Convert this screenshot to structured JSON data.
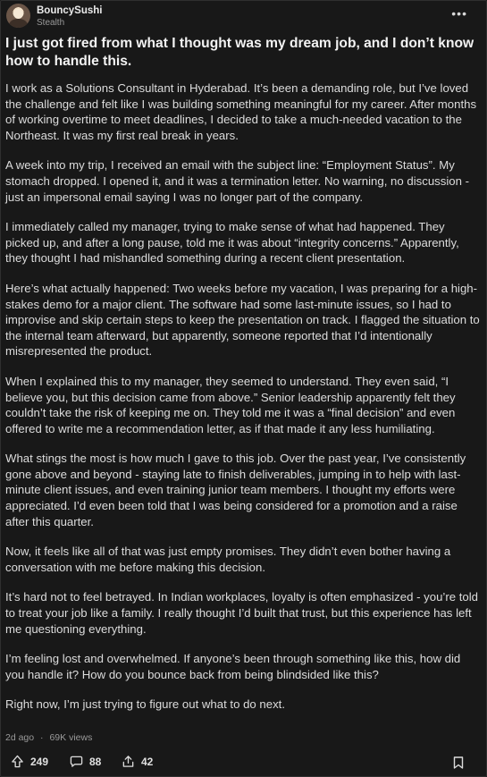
{
  "post": {
    "author": "BouncySushi",
    "author_sub": "Stealth",
    "more_label": "•••",
    "title": "I just got fired from what I thought was my dream job, and I don’t know how to handle this.",
    "paragraphs": [
      "I work as a Solutions Consultant in Hyderabad. It’s been a demanding role, but I’ve loved the challenge and felt like I was building something meaningful for my career. After months of working overtime to meet deadlines, I decided to take a much-needed vacation to the Northeast. It was my first real break in years.",
      "A week into my trip, I received an email with the subject line: “Employment Status”. My stomach dropped. I opened it, and it was a termination letter. No warning, no discussion - just an impersonal email saying I was no longer part of the company.",
      "I immediately called my manager, trying to make sense of what had happened. They picked up, and after a long pause, told me it was about “integrity concerns.” Apparently, they thought I had mishandled something during a recent client presentation.",
      "Here’s what actually happened: Two weeks before my vacation, I was preparing for a high-stakes demo for a major client. The software had some last-minute issues, so I had to improvise and skip certain steps to keep the presentation on track. I flagged the situation to the internal team afterward, but apparently, someone reported that I’d intentionally misrepresented the product.",
      "When I explained this to my manager, they seemed to understand. They even said, “I believe you, but this decision came from above.” Senior leadership apparently felt they couldn’t take the risk of keeping me on. They told me it was a “final decision” and even offered to write me a recommendation letter, as if that made it any less humiliating.",
      "What stings the most is how much I gave to this job. Over the past year, I’ve consistently gone above and beyond - staying late to finish deliverables, jumping in to help with last-minute client issues, and even training junior team members. I thought my efforts were appreciated. I’d even been told that I was being considered for a promotion and a raise after this quarter.",
      "Now, it feels like all of that was just empty promises. They didn’t even bother having a conversation with me before making this decision.",
      "It’s hard not to feel betrayed. In Indian workplaces, loyalty is often emphasized - you’re told to treat your job like a family. I really thought I’d built that trust, but this experience has left me questioning everything.",
      "I’m feeling lost and overwhelmed. If anyone’s been through something like this, how did you handle it? How do you bounce back from being blindsided like this?",
      "Right now, I’m just trying to figure out what to do next."
    ],
    "time_ago": "2d ago",
    "separator": "·",
    "views": "69K views",
    "upvotes": "249",
    "comments": "88",
    "shares": "42"
  },
  "icons": {
    "upvote": "arrow-up-icon",
    "comment": "comment-icon",
    "share": "share-icon",
    "bookmark": "bookmark-icon",
    "more": "more-options-icon"
  }
}
